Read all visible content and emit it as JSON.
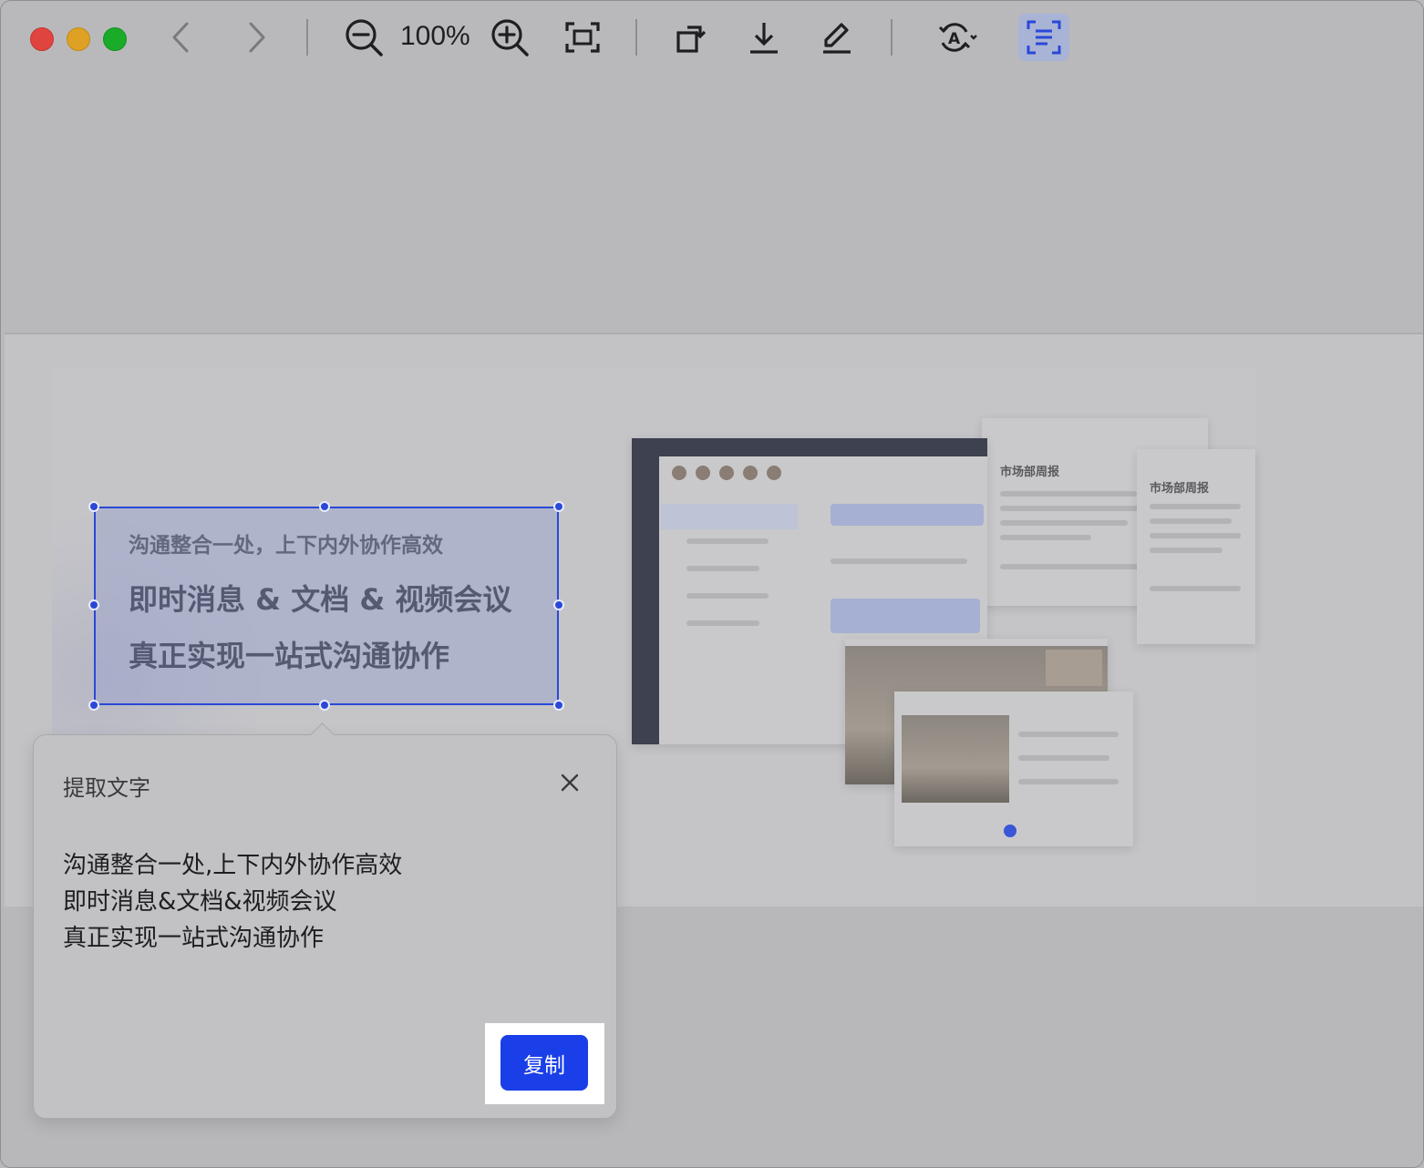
{
  "toolbar": {
    "zoom_level": "100%",
    "traffic_lights": {
      "close": "#e0443e",
      "minimize": "#dea123",
      "maximize": "#1aab29"
    },
    "icons": [
      "back-icon",
      "forward-icon",
      "zoom-out-icon",
      "zoom-in-icon",
      "fit-screen-icon",
      "rotate-icon",
      "download-icon",
      "edit-icon",
      "translate-icon",
      "extract-text-icon"
    ]
  },
  "selection": {
    "lines": [
      "沟通整合一处，上下内外协作高效",
      "即时消息 & 文档 & 视频会议",
      "真正实现一站式沟通协作"
    ]
  },
  "extract_popup": {
    "title": "提取文字",
    "lines": [
      "沟通整合一处,上下内外协作高效",
      "即时消息&文档&视频会议",
      "真正实现一站式沟通协作"
    ],
    "copy_label": "复制"
  },
  "colors": {
    "accent": "#1a3ee8",
    "selection_border": "#2a48d6"
  }
}
